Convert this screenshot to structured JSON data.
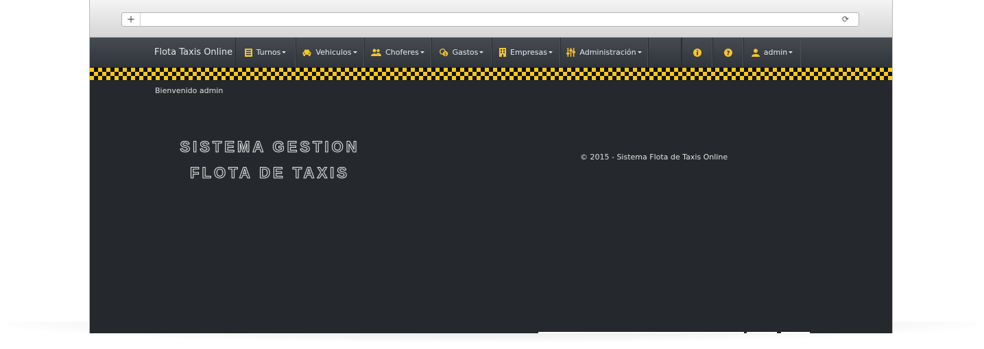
{
  "browser": {
    "new_tab_symbol": "+",
    "reload_symbol": "⟳"
  },
  "navbar": {
    "brand": "Flota Taxis Online",
    "items": [
      {
        "label": "Turnos",
        "icon": "book-icon"
      },
      {
        "label": "Vehiculos",
        "icon": "car-icon"
      },
      {
        "label": "Choferes",
        "icon": "users-icon"
      },
      {
        "label": "Gastos",
        "icon": "coins-icon"
      },
      {
        "label": "Empresas",
        "icon": "building-icon"
      },
      {
        "label": "Administración",
        "icon": "sliders-icon"
      }
    ],
    "right": [
      {
        "icon": "info-icon"
      },
      {
        "icon": "help-icon"
      },
      {
        "label": "admin",
        "icon": "user-icon"
      }
    ]
  },
  "welcome": "Bienvenido admin",
  "hero": {
    "line1": "SISTEMA GESTION",
    "line2": "FLOTA DE TAXIS"
  },
  "footer": "© 2015 - Sistema Flota de Taxis Online",
  "colors": {
    "accent": "#f4c430",
    "background": "#25282c",
    "navbar": "#3a3f44"
  }
}
